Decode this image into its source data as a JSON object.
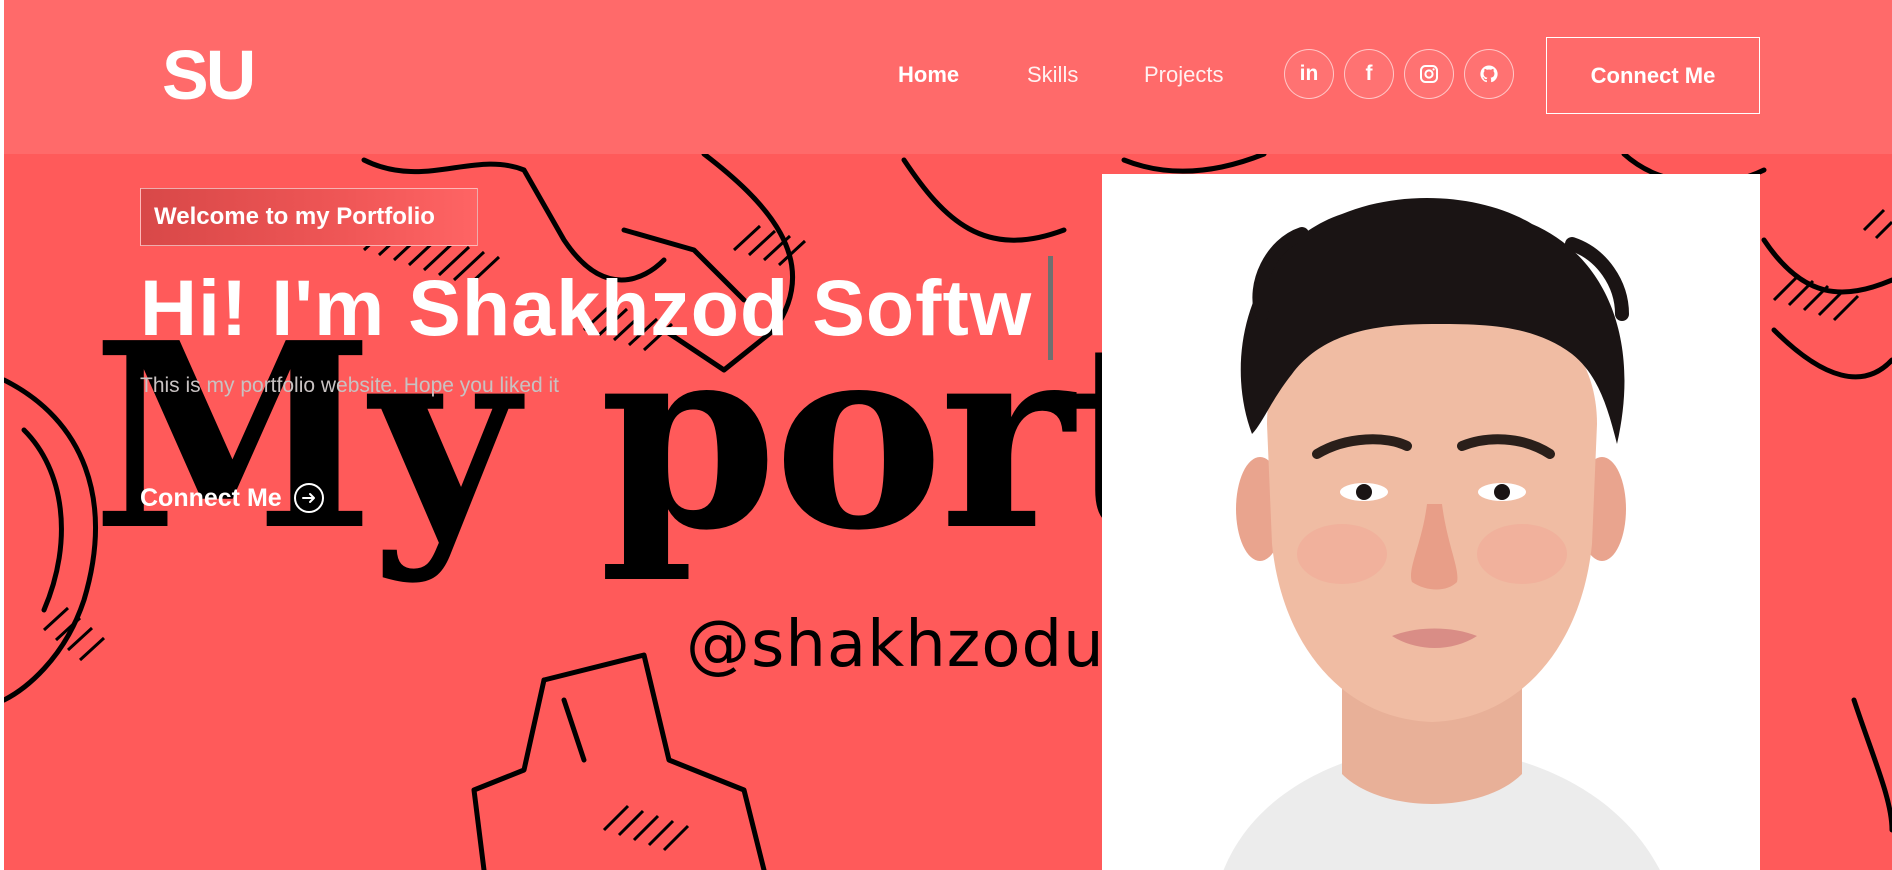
{
  "navbar": {
    "logo": "SU",
    "links": [
      {
        "label": "Home",
        "active": true
      },
      {
        "label": "Skills",
        "active": false
      },
      {
        "label": "Projects",
        "active": false
      }
    ],
    "social_icons": [
      "linkedin-icon",
      "facebook-icon",
      "instagram-icon",
      "github-icon"
    ],
    "cta_label": "Connect Me"
  },
  "hero": {
    "tagline": "Welcome to my Portfolio",
    "title": "Hi! I'm Shakhzod Softw",
    "subtitle": "This is my portfolio website. Hope you liked it",
    "cta_label": "Connect Me",
    "background_text": "My port",
    "background_handle": "@shakhzoduma"
  },
  "colors": {
    "page_bg": "#ff5a5a",
    "navbar_bg": "#ff6a6a",
    "text": "#ffffff",
    "muted_text": "#c8c2c2",
    "doodle": "#000000"
  }
}
